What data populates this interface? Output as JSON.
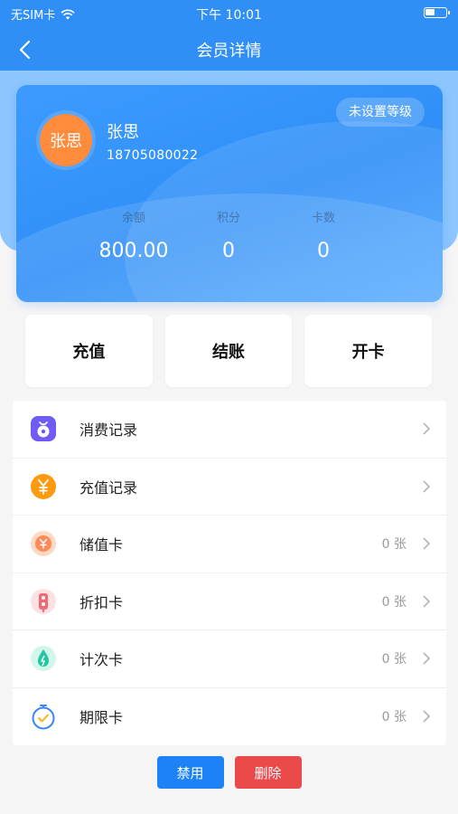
{
  "status_bar": {
    "carrier": "无SIM卡",
    "time": "下午 10:01"
  },
  "nav": {
    "title": "会员详情"
  },
  "member": {
    "avatar_text": "张思",
    "name": "张思",
    "phone": "18705080022",
    "level": "未设置等级",
    "stats": [
      {
        "label": "余额",
        "value": "800.00"
      },
      {
        "label": "积分",
        "value": "0"
      },
      {
        "label": "卡数",
        "value": "0"
      }
    ]
  },
  "actions": [
    {
      "label": "充值"
    },
    {
      "label": "结账"
    },
    {
      "label": "开卡"
    }
  ],
  "menu": [
    {
      "label": "消费记录",
      "count": "",
      "icon": "money-bag-icon",
      "color": "#6e5cf5"
    },
    {
      "label": "充值记录",
      "count": "",
      "icon": "yen-coin-icon",
      "color": "#ff9a0e"
    },
    {
      "label": "储值卡",
      "count": "0 张",
      "icon": "stored-value-icon",
      "color": "#ff8b5a"
    },
    {
      "label": "折扣卡",
      "count": "0 张",
      "icon": "discount-icon",
      "color": "#f06b75"
    },
    {
      "label": "计次卡",
      "count": "0 张",
      "icon": "count-card-icon",
      "color": "#1fc8a0"
    },
    {
      "label": "期限卡",
      "count": "0 张",
      "icon": "timer-icon",
      "color": "#3d84f5"
    }
  ],
  "bottom": {
    "disable_label": "禁用",
    "delete_label": "删除"
  },
  "colors": {
    "primary": "#2f8ff7",
    "danger": "#ea4a4a"
  }
}
